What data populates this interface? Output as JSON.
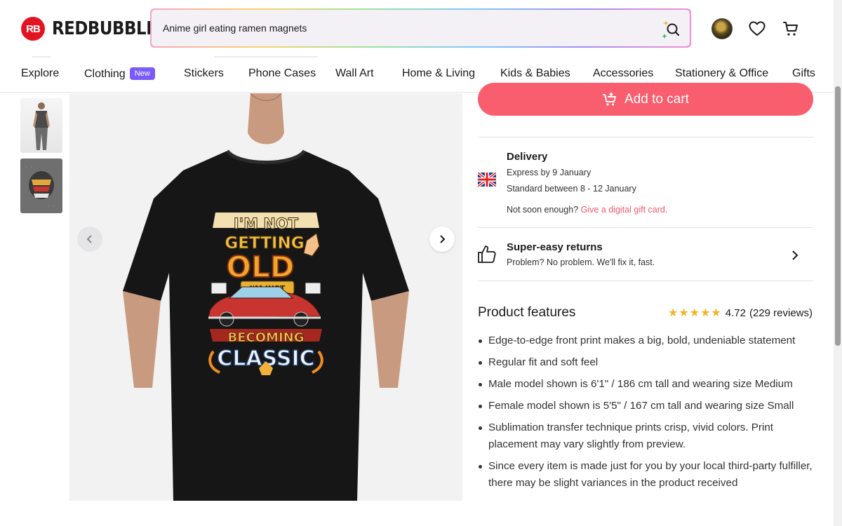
{
  "header": {
    "logo_mark": "RB",
    "logo_text": "REDBUBBLE",
    "search_value": "Anime girl eating ramen magnets",
    "icons": [
      "avatar",
      "heart-icon",
      "cart-icon"
    ]
  },
  "nav": {
    "items": [
      {
        "label": "Explore"
      },
      {
        "label": "Clothing",
        "badge": "New"
      },
      {
        "label": "Stickers"
      },
      {
        "label": "Phone Cases"
      },
      {
        "label": "Wall Art"
      },
      {
        "label": "Home & Living"
      },
      {
        "label": "Kids & Babies"
      },
      {
        "label": "Accessories"
      },
      {
        "label": "Stationery & Office"
      },
      {
        "label": "Gifts"
      }
    ]
  },
  "product": {
    "print_lines": [
      "I'M NOT",
      "GETTING",
      "OLD",
      "I'M JUST",
      "BECOMING",
      "CLASSIC"
    ],
    "add_to_cart": "Add to cart",
    "delivery": {
      "title": "Delivery",
      "express": "Express by 9 January",
      "standard": "Standard between 8 - 12 January",
      "not_soon": "Not soon enough?",
      "gift_link": "Give a digital gift card."
    },
    "returns": {
      "title": "Super-easy returns",
      "subtitle": "Problem? No problem. We'll fix it, fast."
    },
    "features_title": "Product features",
    "rating_value": "4.72",
    "rating_count": "(229 reviews)",
    "rating_stars": 5,
    "features": [
      "Edge-to-edge front print makes a big, bold, undeniable statement",
      "Regular fit and soft feel",
      "Male model shown is 6'1\" / 186 cm tall and wearing size Medium",
      "Female model shown is 5'5\" / 167 cm tall and wearing size Small",
      "Sublimation transfer technique prints crisp, vivid colors. Print placement may vary slightly from preview.",
      "Since every item is made just for you by your local third-party fulfiller, there may be slight variances in the product received"
    ]
  },
  "colors": {
    "brand_red": "#e41321",
    "cart_button": "#f85e6e",
    "gift_link": "#f05a6a",
    "badge": "#7a5af8",
    "star": "#f5b323"
  }
}
